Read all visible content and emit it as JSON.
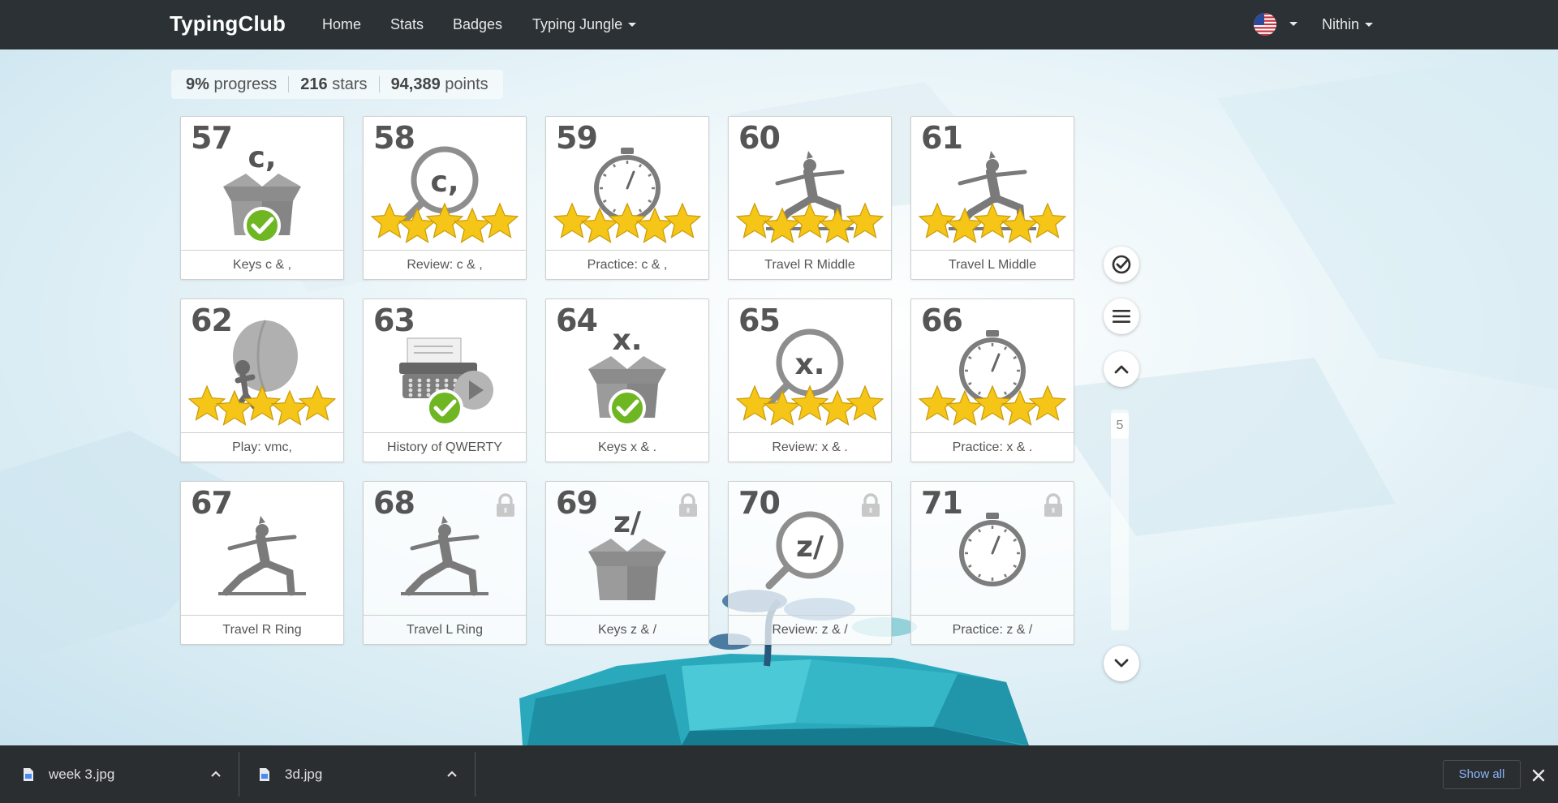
{
  "navbar": {
    "brand": "TypingClub",
    "links": {
      "home": "Home",
      "stats": "Stats",
      "badges": "Badges",
      "jungle": "Typing Jungle"
    },
    "user": "Nithin"
  },
  "progress": {
    "percent": "9%",
    "percent_label": "progress",
    "stars": "216",
    "stars_label": "stars",
    "points": "94,389",
    "points_label": "points"
  },
  "lessons": [
    {
      "num": "57",
      "label": "Keys c & ,",
      "glyph": "c,",
      "icon": "box-icon",
      "status": "check",
      "stars": 0,
      "locked": false
    },
    {
      "num": "58",
      "label": "Review: c & ,",
      "glyph": "c,",
      "icon": "magnifier-icon",
      "status": "stars",
      "stars": 5,
      "locked": false
    },
    {
      "num": "59",
      "label": "Practice: c & ,",
      "glyph": "",
      "icon": "stopwatch-icon",
      "status": "stars",
      "stars": 5,
      "locked": false
    },
    {
      "num": "60",
      "label": "Travel R Middle",
      "glyph": "",
      "icon": "yoga-icon",
      "status": "stars",
      "stars": 5,
      "locked": false
    },
    {
      "num": "61",
      "label": "Travel L Middle",
      "glyph": "",
      "icon": "yoga-icon",
      "status": "stars",
      "stars": 5,
      "locked": false
    },
    {
      "num": "62",
      "label": "Play: vmc,",
      "glyph": "",
      "icon": "balloon-icon",
      "status": "stars",
      "stars": 5,
      "locked": false
    },
    {
      "num": "63",
      "label": "History of QWERTY",
      "glyph": "",
      "icon": "typewriter-icon",
      "status": "check",
      "stars": 0,
      "locked": false
    },
    {
      "num": "64",
      "label": "Keys x & .",
      "glyph": "x.",
      "icon": "box-icon",
      "status": "check",
      "stars": 0,
      "locked": false
    },
    {
      "num": "65",
      "label": "Review: x & .",
      "glyph": "x.",
      "icon": "magnifier-icon",
      "status": "stars",
      "stars": 5,
      "locked": false
    },
    {
      "num": "66",
      "label": "Practice: x & .",
      "glyph": "",
      "icon": "stopwatch-icon",
      "status": "stars",
      "stars": 5,
      "locked": false
    },
    {
      "num": "67",
      "label": "Travel R Ring",
      "glyph": "",
      "icon": "yoga-icon",
      "status": "none",
      "stars": 0,
      "locked": false
    },
    {
      "num": "68",
      "label": "Travel L Ring",
      "glyph": "",
      "icon": "yoga-icon",
      "status": "none",
      "stars": 0,
      "locked": true
    },
    {
      "num": "69",
      "label": "Keys z & /",
      "glyph": "z/",
      "icon": "box-icon",
      "status": "none",
      "stars": 0,
      "locked": true
    },
    {
      "num": "70",
      "label": "Review: z & /",
      "glyph": "z/",
      "icon": "magnifier-icon",
      "status": "none",
      "stars": 0,
      "locked": true
    },
    {
      "num": "71",
      "label": "Practice: z & /",
      "glyph": "",
      "icon": "stopwatch-icon",
      "status": "none",
      "stars": 0,
      "locked": true
    }
  ],
  "side": {
    "page": "5"
  },
  "downloads": {
    "items": [
      {
        "name": "week 3.jpg"
      },
      {
        "name": "3d.jpg"
      }
    ],
    "show_all": "Show all"
  }
}
